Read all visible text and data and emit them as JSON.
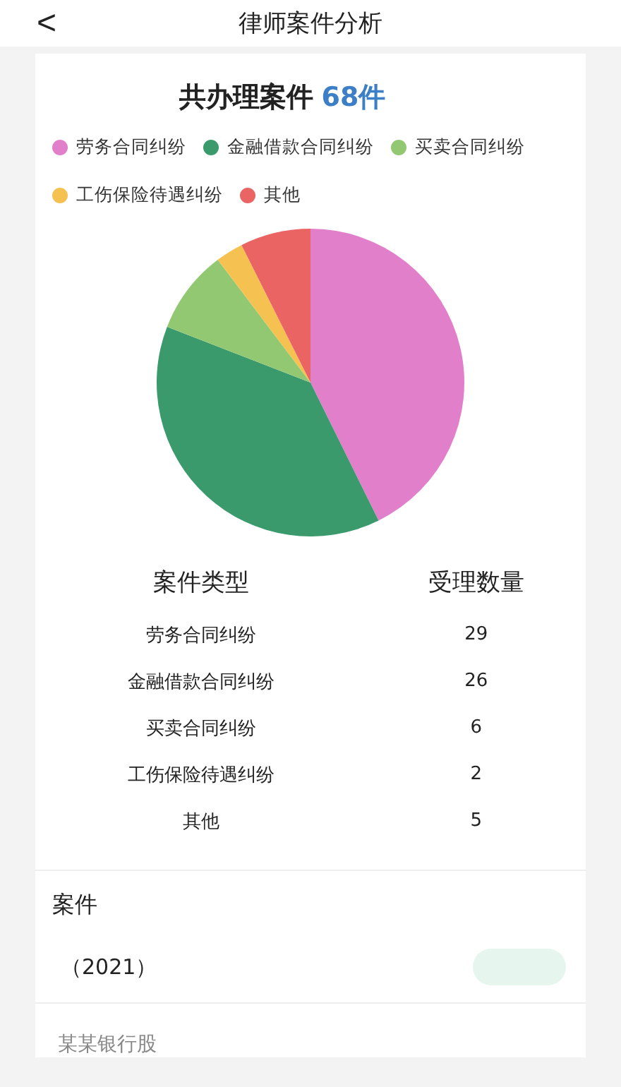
{
  "header": {
    "back": "<",
    "title": "律师案件分析"
  },
  "summary": {
    "label": "共办理案件",
    "count": "68件"
  },
  "legend": [
    {
      "color": "#e27fcb"
    },
    {
      "color": "#3a9a6c"
    },
    {
      "color": "#93c872"
    },
    {
      "color": "#f5c150"
    },
    {
      "color": "#ea6464"
    }
  ],
  "chart_data": {
    "type": "pie",
    "categories": [
      "劳务合同纠纷",
      "金融借款合同纠纷",
      "买卖合同纠纷",
      "工伤保险待遇纠纷",
      "其他"
    ],
    "values": [
      42.7,
      38.2,
      8.8,
      2.9,
      7.4
    ]
  },
  "table": {
    "columns": [
      "案件类型",
      "受理数量"
    ],
    "rows": [
      [
        "劳务合同纠纷",
        "29"
      ],
      [
        "金融借款合同纠纷",
        "26"
      ],
      [
        "买卖合同纠纷",
        "6"
      ],
      [
        "工伤保险待遇纠纷",
        "2"
      ],
      [
        "其他",
        "5"
      ]
    ]
  },
  "cases": {
    "title": "案件",
    "items": [
      {
        "number": "（2021）",
        "description": "某某银行股"
      }
    ]
  }
}
